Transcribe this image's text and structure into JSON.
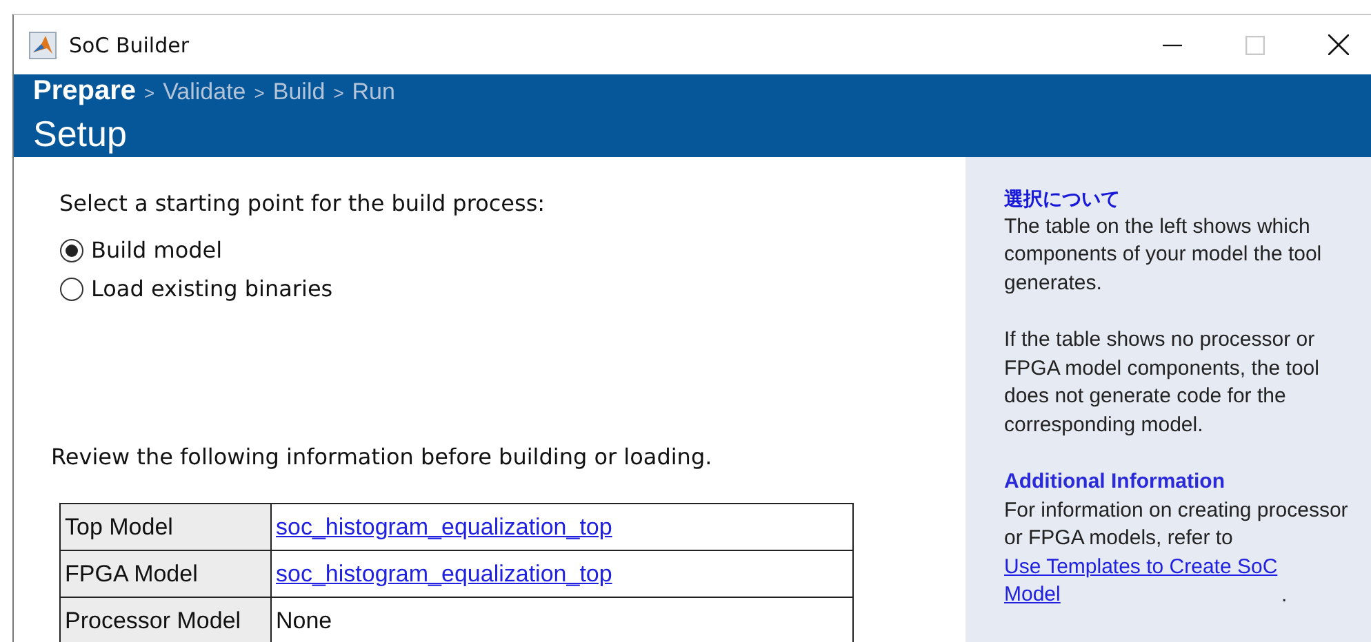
{
  "window": {
    "title": "SoC Builder",
    "maximize_disabled": true
  },
  "breadcrumb": [
    {
      "label": "Prepare",
      "selected": true
    },
    {
      "separator": ">",
      "label": "Validate",
      "selected": false
    },
    {
      "separator": ">",
      "label": "Build",
      "selected": false
    },
    {
      "separator": ">",
      "label": "Run",
      "selected": false
    }
  ],
  "page_title": "Setup",
  "prompt": "Select a starting point for the build process:",
  "options": [
    {
      "label": "Build model",
      "selected": true
    },
    {
      "label": "Load existing binaries",
      "selected": false
    }
  ],
  "review_text": "Review the following information before building or loading.",
  "table": {
    "rows": [
      {
        "label": "Top Model",
        "value": "soc_histogram_equalization_top",
        "kind": "link"
      },
      {
        "label": "FPGA Model",
        "value": "soc_histogram_equalization_top",
        "kind": "link"
      },
      {
        "label": "Processor Model",
        "value": "None",
        "kind": "text"
      }
    ]
  },
  "help": {
    "heading": "選択について",
    "paragraphs": [
      "The table on the left shows which components of your model the tool generates.",
      "If the table shows no processor or FPGA model components, the tool does not generate code for the corresponding model."
    ],
    "subheading": "Additional Information",
    "info_text": "For information on creating processor or FPGA models, refer to",
    "info_link": "Use Templates to Create SoC Model",
    "info_end": "."
  }
}
